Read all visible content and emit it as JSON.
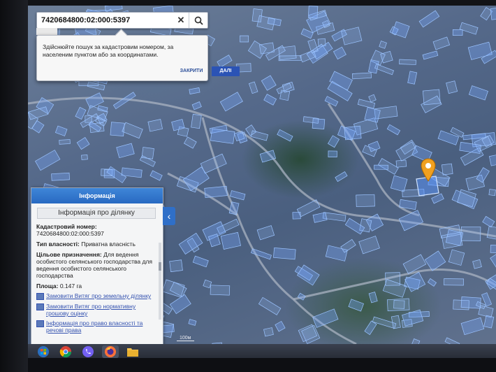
{
  "search": {
    "value": "7420684800:02:000:5397",
    "clear_icon": "close-icon",
    "search_icon": "search-icon"
  },
  "tooltip": {
    "text": "Здійснюйте пошук за кадастровим номером, за населеним пунктом або за координатами.",
    "close_label": "ЗАКРИТИ",
    "next_label": "ДАЛІ"
  },
  "info_panel": {
    "header": "Інформація",
    "subtitle": "Інформація про ділянку",
    "cadastral_label": "Кадастровий номер:",
    "cadastral_value": "7420684800:02:000:5397",
    "ownership_label": "Тип власності:",
    "ownership_value": "Приватна власність",
    "purpose_label": "Цільове призначення:",
    "purpose_value": "Для ведення особистого селянського господарства для ведення особистого селянського господарства",
    "area_label": "Площа:",
    "area_value": "0.147 га",
    "links": [
      "Замовити Витяг про земельну ділянку",
      "Замовити Витяг про нормативну грошову оцінку",
      "Інформація про право власності та речові права"
    ]
  },
  "map": {
    "scale_label": "100м",
    "marker_color": "#f0a020"
  },
  "taskbar": {
    "icons": [
      "windows-start-icon",
      "chrome-icon",
      "viber-icon",
      "firefox-icon",
      "folder-icon"
    ]
  }
}
